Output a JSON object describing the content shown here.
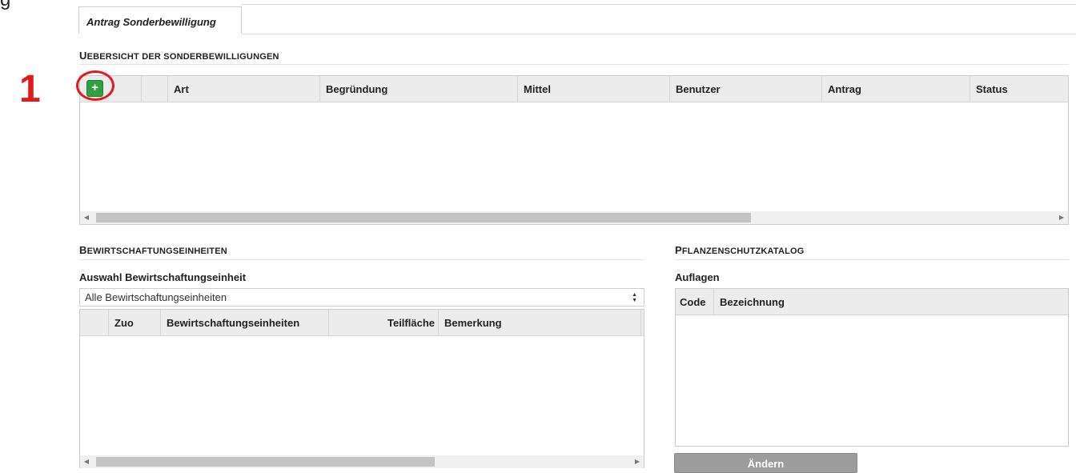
{
  "top_text": "g",
  "tab": {
    "label": "Antrag Sonderbewilligung"
  },
  "annotation": {
    "number": "1"
  },
  "uebersicht": {
    "title": "Uebersicht der Sonderbewilligungen",
    "add_label": "+",
    "columns": [
      "Art",
      "Begründung",
      "Mittel",
      "Benutzer",
      "Antrag",
      "Status"
    ]
  },
  "bewirtschaftung": {
    "title": "Bewirtschaftungseinheiten",
    "select_label": "Auswahl Bewirtschaftungseinheit",
    "select_value": "Alle Bewirtschaftungseinheiten",
    "columns": [
      "Zuo",
      "Bewirtschaftungseinheiten",
      "Teilfläche",
      "Bemerkung"
    ]
  },
  "pflanzenschutz": {
    "title": "Pflanzenschutzkatalog",
    "auflagen_label": "Auflagen",
    "columns": [
      "Code",
      "Bezeichnung"
    ],
    "button_label": "Ändern"
  },
  "colors": {
    "add_button": "#2fa043",
    "annotation": "#e01b1b",
    "header_bg": "#ececec",
    "disabled_button": "#9c9c9c"
  }
}
